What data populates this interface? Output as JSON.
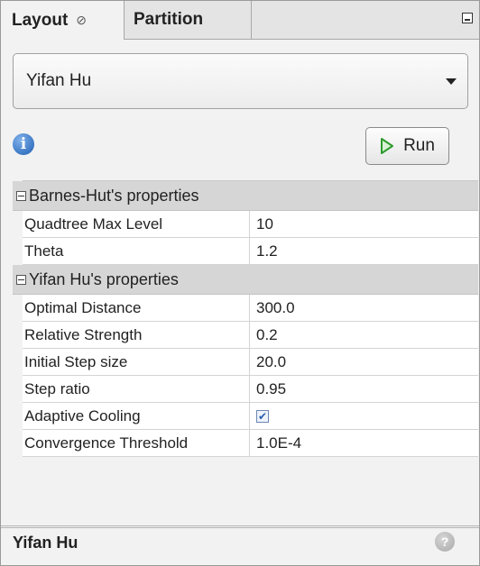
{
  "tabs": {
    "layout_label": "Layout",
    "layout_close": "⊘",
    "partition_label": "Partition"
  },
  "algorithm_select": {
    "value": "Yifan Hu"
  },
  "toolbar": {
    "run_label": "Run"
  },
  "sections": [
    {
      "title": "Barnes-Hut's properties",
      "rows": [
        {
          "name": "Quadtree Max Level",
          "value": "10"
        },
        {
          "name": "Theta",
          "value": "1.2"
        }
      ]
    },
    {
      "title": "Yifan Hu's properties",
      "rows": [
        {
          "name": "Optimal Distance",
          "value": "300.0"
        },
        {
          "name": "Relative Strength",
          "value": "0.2"
        },
        {
          "name": "Initial Step size",
          "value": "20.0"
        },
        {
          "name": "Step ratio",
          "value": "0.95"
        },
        {
          "name": "Adaptive Cooling",
          "checked": true
        },
        {
          "name": "Convergence Threshold",
          "value": "1.0E-4"
        }
      ]
    }
  ],
  "description": {
    "title": "Yifan Hu"
  },
  "icons": {
    "info": "info-icon",
    "help": "help-icon",
    "run": "play-icon"
  },
  "colors": {
    "run_icon_green": "#2e9c2e",
    "info_blue": "#1f5fb4"
  }
}
